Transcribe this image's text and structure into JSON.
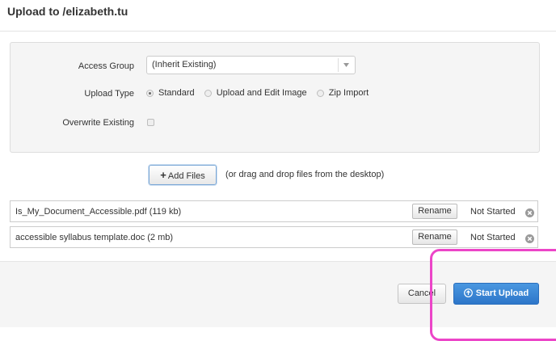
{
  "dialog": {
    "title": "Upload to /elizabeth.tu"
  },
  "settings": {
    "access_group_label": "Access Group",
    "access_group_value": "(Inherit Existing)",
    "upload_type_label": "Upload Type",
    "upload_type_options": [
      {
        "label": "Standard",
        "selected": true
      },
      {
        "label": "Upload and Edit Image",
        "selected": false
      },
      {
        "label": "Zip Import",
        "selected": false
      }
    ],
    "overwrite_label": "Overwrite Existing",
    "overwrite_checked": false
  },
  "add_files": {
    "button_label": "Add Files",
    "hint": "(or drag and drop files from the desktop)"
  },
  "files": [
    {
      "name": "Is_My_Document_Accessible.pdf (119 kb)",
      "rename_label": "Rename",
      "status": "Not Started"
    },
    {
      "name": "accessible syllabus template.doc (2 mb)",
      "rename_label": "Rename",
      "status": "Not Started"
    }
  ],
  "footer": {
    "cancel_label": "Cancel",
    "start_label": "Start Upload"
  },
  "colors": {
    "primary_button": "#2d76c9",
    "highlight": "#ec45c8"
  },
  "icons": {
    "add": "plus-icon",
    "remove": "remove-circle-icon",
    "upload": "upload-arrow-icon",
    "dropdown": "caret-down-icon"
  }
}
